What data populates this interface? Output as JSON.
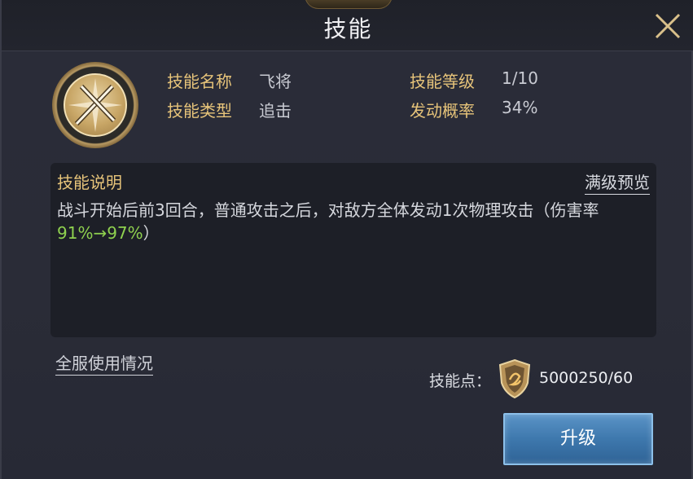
{
  "header": {
    "title": "技能"
  },
  "skill": {
    "icon": "crossed-swords-icon",
    "name_label": "技能名称",
    "name_value": "飞将",
    "type_label": "技能类型",
    "type_value": "追击",
    "level_label": "技能等级",
    "level_value": "1/10",
    "rate_label": "发动概率",
    "rate_value": "34%"
  },
  "description": {
    "title": "技能说明",
    "max_preview_link": "满级预览",
    "text_prefix": "战斗开始后前3回合，普通攻击之后，对敌方全体发动1次物理攻击（伤害率",
    "text_highlight": "91%→97%",
    "text_suffix": "）"
  },
  "footer": {
    "server_usage_link": "全服使用情况",
    "points_label": "技能点：",
    "points_icon": "shield-icon",
    "points_value": "5000250/60",
    "upgrade_button": "升级"
  },
  "colors": {
    "gold_label": "#e7c47a",
    "highlight_green": "#8fd14f",
    "button_blue": "#3e78ad"
  }
}
